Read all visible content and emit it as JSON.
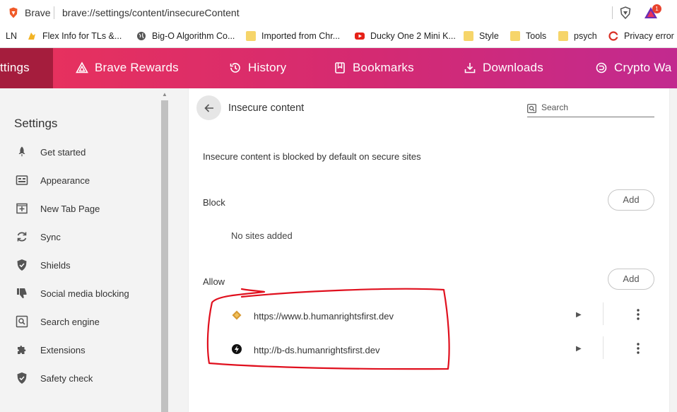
{
  "browser": {
    "app_name": "Brave",
    "url": "brave://settings/content/insecureContent",
    "rewards_badge": "1"
  },
  "bookmarks": [
    {
      "label": "LN",
      "icon": "none-icon"
    },
    {
      "label": "Flex Info for TLs &...",
      "icon": "flex-icon"
    },
    {
      "label": "Big-O Algorithm Co...",
      "icon": "globe-icon"
    },
    {
      "label": "Imported from Chr...",
      "icon": "folder-icon"
    },
    {
      "label": "Ducky One 2 Mini K...",
      "icon": "youtube-icon"
    },
    {
      "label": "Style",
      "icon": "folder-icon"
    },
    {
      "label": "Tools",
      "icon": "folder-icon"
    },
    {
      "label": "psych",
      "icon": "folder-icon"
    },
    {
      "label": "Privacy error",
      "icon": "error-icon"
    }
  ],
  "nav": {
    "items": [
      "ttings",
      "Brave Rewards",
      "History",
      "Bookmarks",
      "Downloads",
      "Crypto Wa"
    ]
  },
  "sidebar": {
    "title": "Settings",
    "items": [
      {
        "label": "Get started",
        "icon": "rocket-icon"
      },
      {
        "label": "Appearance",
        "icon": "appearance-icon"
      },
      {
        "label": "New Tab Page",
        "icon": "new-tab-icon"
      },
      {
        "label": "Sync",
        "icon": "sync-icon"
      },
      {
        "label": "Shields",
        "icon": "shield-icon"
      },
      {
        "label": "Social media blocking",
        "icon": "thumbs-down-icon"
      },
      {
        "label": "Search engine",
        "icon": "search-engine-icon"
      },
      {
        "label": "Extensions",
        "icon": "puzzle-icon"
      },
      {
        "label": "Safety check",
        "icon": "safety-shield-icon"
      }
    ]
  },
  "main": {
    "title": "Insecure content",
    "search_placeholder": "Search",
    "description": "Insecure content is blocked by default on secure sites",
    "block": {
      "label": "Block",
      "add_label": "Add",
      "empty_text": "No sites added"
    },
    "allow": {
      "label": "Allow",
      "add_label": "Add",
      "sites": [
        {
          "url": "https://www.b.humanrightsfirst.dev",
          "icon": "diamond-icon"
        },
        {
          "url": "http://b-ds.humanrightsfirst.dev",
          "icon": "bolt-icon"
        }
      ]
    }
  },
  "colors": {
    "nav_start": "#e9325b",
    "nav_end": "#c22a8f",
    "nav_active": "#a51d3d",
    "annotation": "#e0101e"
  }
}
